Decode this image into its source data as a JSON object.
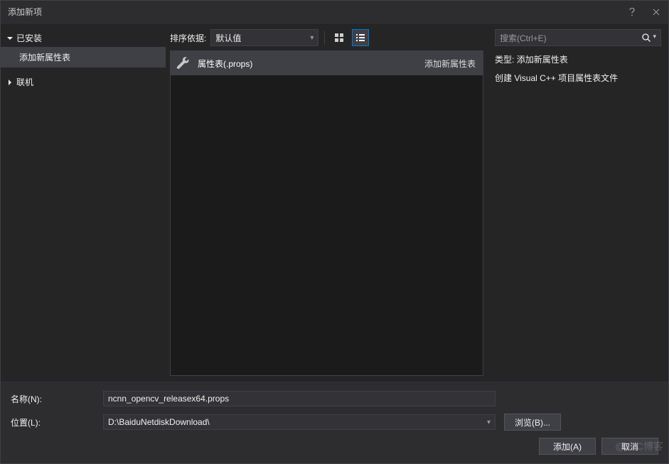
{
  "title": "添加新项",
  "titlebar": {
    "help_icon": "help-icon",
    "close_icon": "close-icon"
  },
  "sidebar": {
    "installed": {
      "label": "已安装",
      "expanded": true,
      "items": [
        {
          "label": "添加新属性表"
        }
      ]
    },
    "online": {
      "label": "联机",
      "expanded": false
    }
  },
  "toolbar": {
    "sort_label": "排序依据:",
    "sort_value": "默认值",
    "view_icons": "icons",
    "view_list": "list"
  },
  "templates": [
    {
      "name": "属性表(.props)",
      "category": "添加新属性表",
      "icon": "wrench-icon",
      "selected": true
    }
  ],
  "search": {
    "placeholder": "搜索(Ctrl+E)"
  },
  "info": {
    "type_label": "类型:",
    "type_value": "添加新属性表",
    "description": "创建 Visual C++ 项目属性表文件"
  },
  "form": {
    "name_label": "名称(N):",
    "name_value": "ncnn_opencv_releasex64.props",
    "location_label": "位置(L):",
    "location_value": "D:\\BaiduNetdiskDownload\\",
    "browse_label": "浏览(B)..."
  },
  "buttons": {
    "add": "添加(A)",
    "cancel": "取消"
  },
  "watermark": "@51C博客"
}
